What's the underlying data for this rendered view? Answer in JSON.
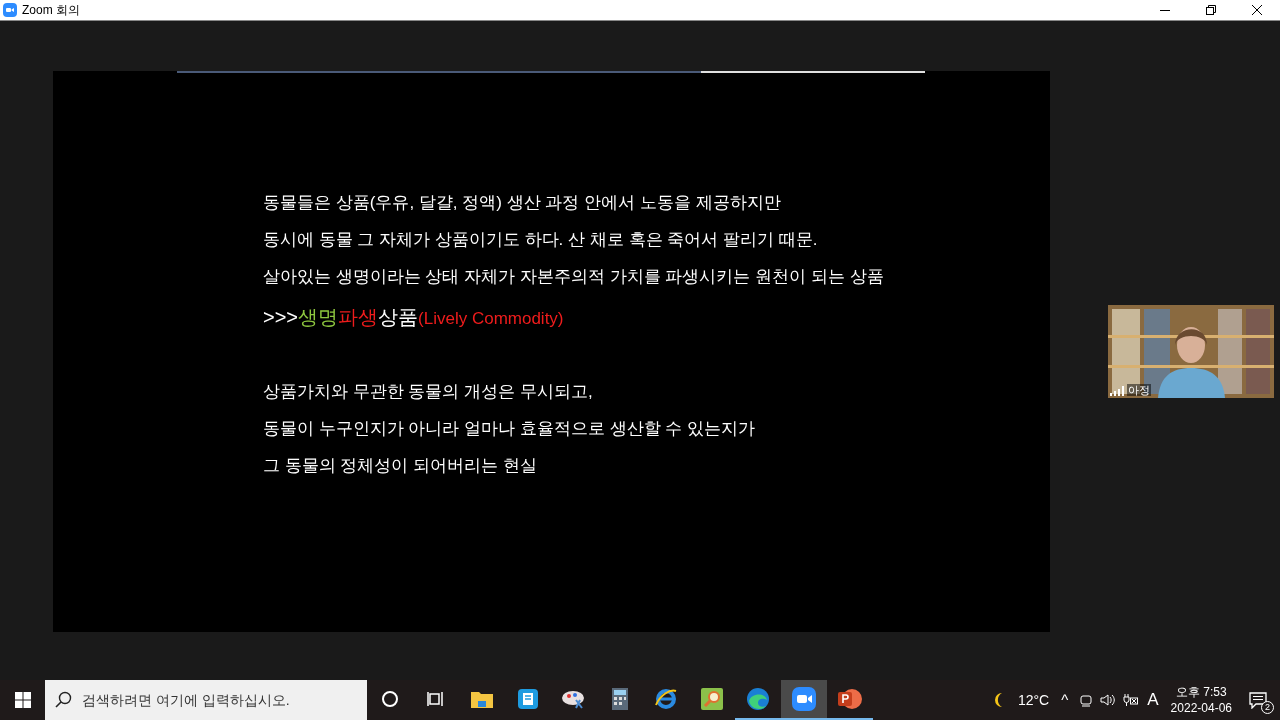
{
  "window": {
    "title": "Zoom 회의"
  },
  "slide": {
    "paragraphs": [
      [
        "동물들은 상품(우유, 달걀, 정액) 생산 과정 안에서 노동을 제공하지만",
        "동시에 동물 그 자체가 상품이기도 하다. 산 채로 혹은 죽어서 팔리기 때문.",
        "살아있는 생명이라는 상태 자체가 자본주의적 가치를 파생시키는 원천이 되는 상품"
      ],
      [
        "상품가치와 무관한 동물의 개성은 무시되고,",
        "동물이 누구인지가 아니라 얼마나 효율적으로 생산할 수 있는지가",
        "그 동물의 정체성이 되어버리는 현실"
      ]
    ],
    "headline": [
      {
        "text": ">>> ",
        "color": "#ffffff"
      },
      {
        "text": "생명",
        "color": "#8dc63f"
      },
      {
        "text": "파생",
        "color": "#ee1c1c"
      },
      {
        "text": "상품",
        "color": "#ffffff"
      },
      {
        "text": "(Lively Commodity)",
        "color": "#ee1c1c"
      }
    ],
    "share_progress": {
      "level": 0.7
    }
  },
  "participant": {
    "name": "아정"
  },
  "taskbar": {
    "search": {
      "placeholder": "검색하려면 여기에 입력하십시오."
    },
    "apps": [
      {
        "kind": "cortana",
        "running": false,
        "active": false
      },
      {
        "kind": "taskview",
        "running": false,
        "active": false
      },
      {
        "kind": "folder",
        "running": false,
        "active": false
      },
      {
        "kind": "book",
        "running": false,
        "active": false
      },
      {
        "kind": "paint",
        "running": false,
        "active": false
      },
      {
        "kind": "calculator",
        "running": false,
        "active": false
      },
      {
        "kind": "ie",
        "running": false,
        "active": false
      },
      {
        "kind": "magnifier",
        "running": false,
        "active": false
      },
      {
        "kind": "edge",
        "running": true,
        "active": false
      },
      {
        "kind": "zoom",
        "running": true,
        "active": true
      },
      {
        "kind": "powerpoint",
        "running": true,
        "active": false
      }
    ],
    "weather": "12°C",
    "caret": "^",
    "ime": "A",
    "time": "오후 7:53",
    "date": "2022-04-06",
    "notifications": "2"
  }
}
